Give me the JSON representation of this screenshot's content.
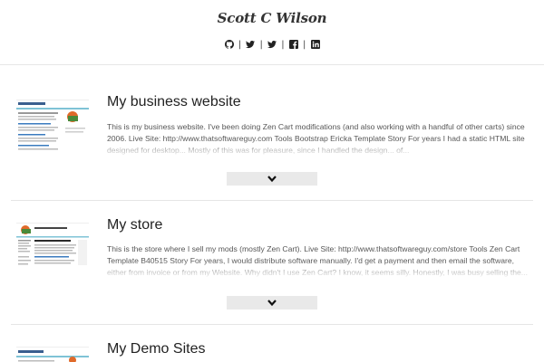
{
  "header": {
    "title": "Scott C Wilson",
    "social": [
      {
        "icon": "github-icon"
      },
      {
        "icon": "twitter-icon"
      },
      {
        "icon": "twitter-icon"
      },
      {
        "icon": "facebook-icon"
      },
      {
        "icon": "linkedin-icon"
      }
    ]
  },
  "projects": [
    {
      "title": "My business website",
      "description": "This is my business website. I've been doing Zen Cart modifications (and also working with a handful of other carts) since 2006. Live Site: http://www.thatsoftwareguy.com Tools Bootstrap Ericka Template Story For years I had a static HTML site designed for desktop... Mostly of this was for pleasure, since I handled the design... of..."
    },
    {
      "title": "My store",
      "description": "This is the store where I sell my mods (mostly Zen Cart). Live Site: http://www.thatsoftwareguy.com/store Tools Zen Cart Template B40515 Story For years, I would distribute software manually. I'd get a payment and then email the software, either from invoice or from my Website. Why didn't I use Zen Cart? I know, it seems silly. Honestly, I was busy selling the..."
    },
    {
      "title": "My Demo Sites",
      "description": ""
    }
  ],
  "colors": {
    "background": "#ffffff",
    "divider": "#e6e6e6",
    "button": "#e9e9e9"
  }
}
